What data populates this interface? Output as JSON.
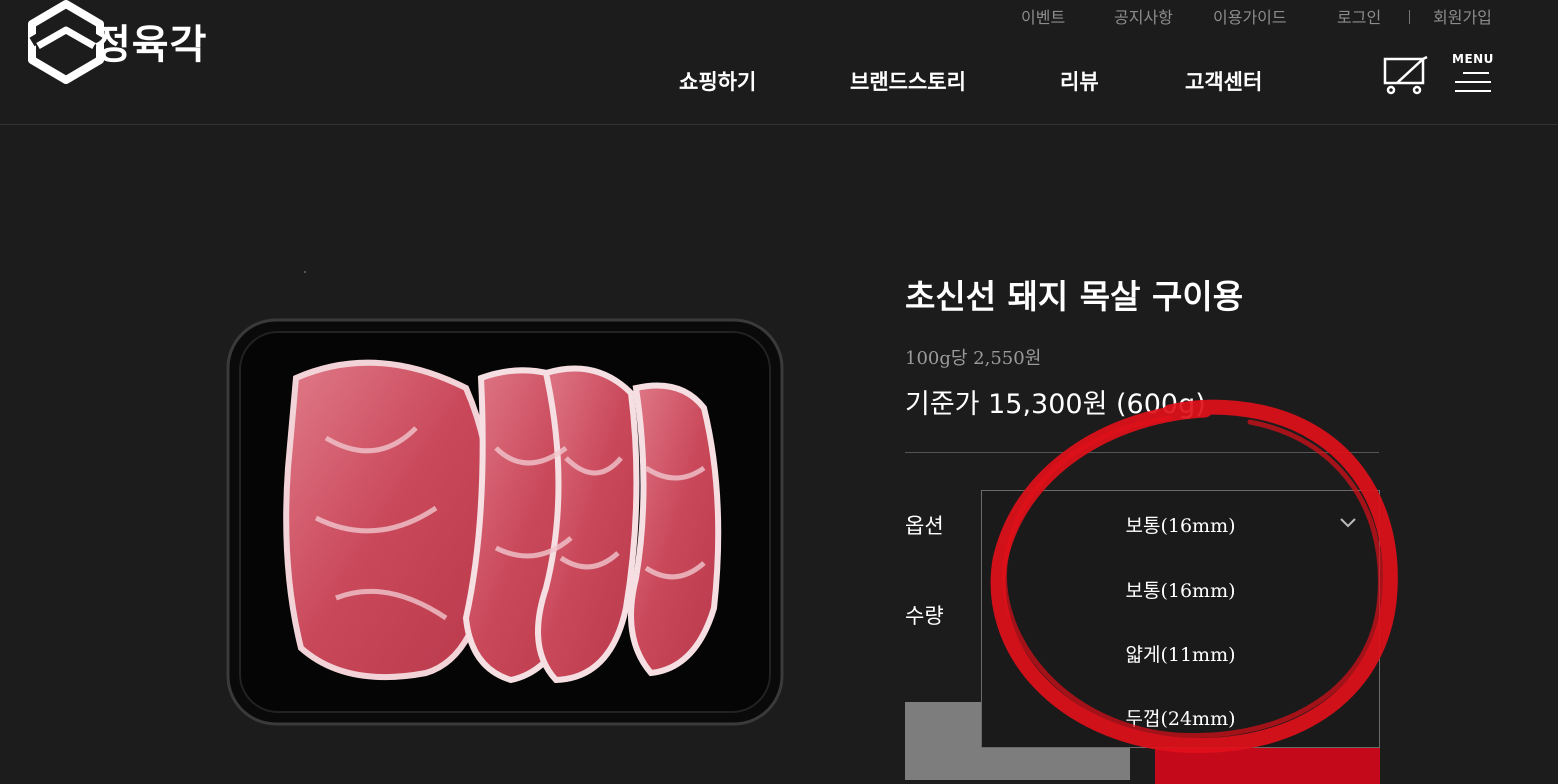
{
  "brand": {
    "name": "정육각"
  },
  "util_nav": [
    "이벤트",
    "공지사항",
    "이용가이드",
    "로그인",
    "회원가입"
  ],
  "main_nav": [
    "쇼핑하기",
    "브랜드스토리",
    "리뷰",
    "고객센터"
  ],
  "menu_label": "MENU",
  "product": {
    "title": "초신선 돼지 목살 구이용",
    "unit_price": "100g당 2,550원",
    "base_price": "기준가 15,300원 (600g)"
  },
  "form": {
    "option_label": "옵션",
    "quantity_label": "수량",
    "selected_option": "보통(16mm)",
    "options": [
      "보통(16mm)",
      "얇게(11mm)",
      "두껍(24mm)"
    ]
  },
  "colors": {
    "background": "#1c1c1c",
    "accent_red": "#c40a1a",
    "annotation_red": "#e0101a"
  },
  "icons": [
    "logo-icon",
    "cart-icon",
    "menu-icon",
    "chevron-down-icon"
  ]
}
